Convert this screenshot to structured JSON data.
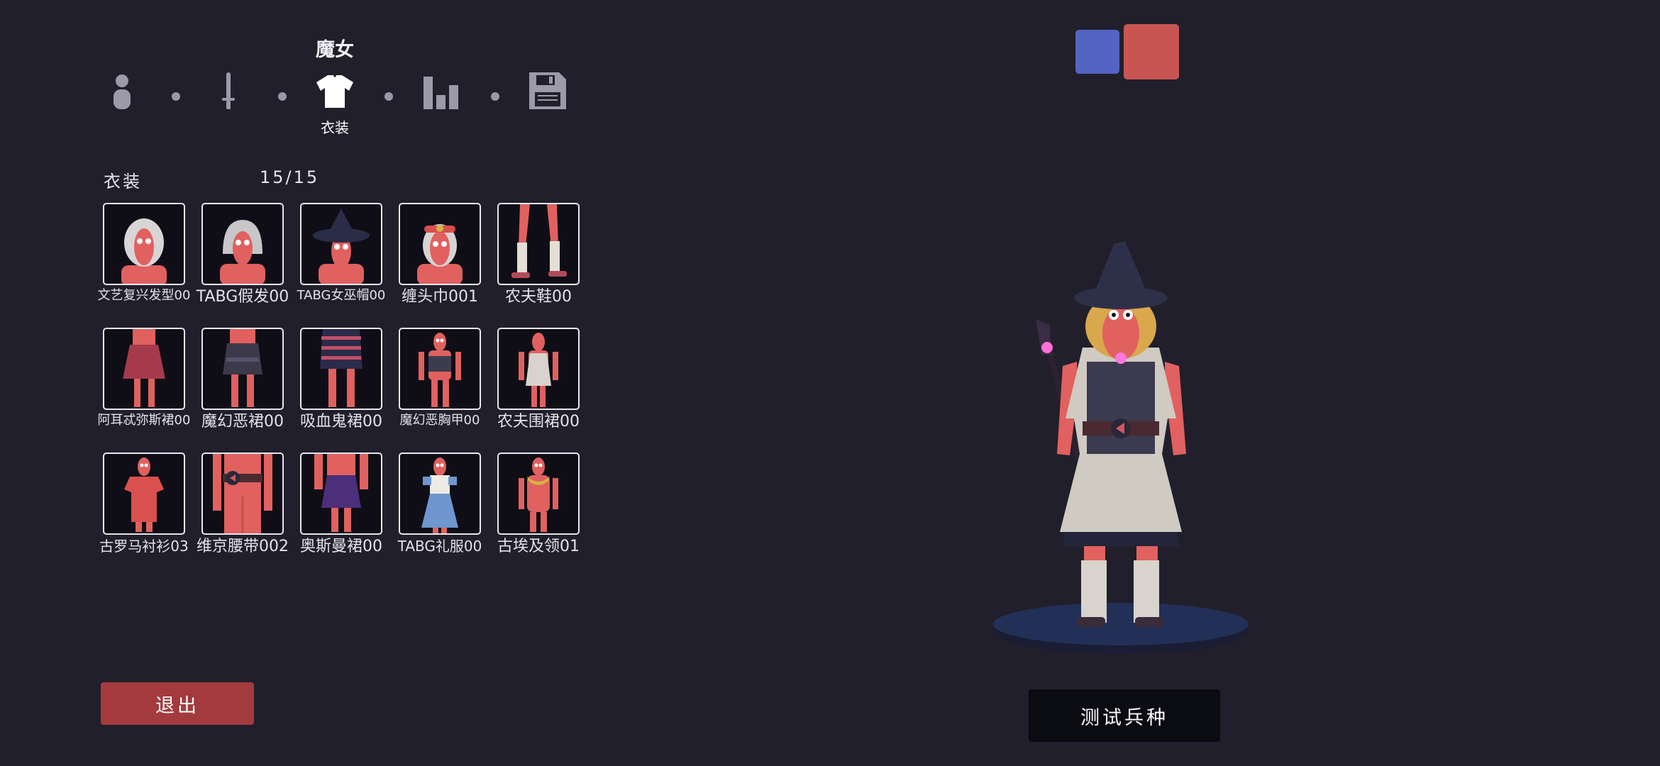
{
  "unit_name": "魔女",
  "steps": [
    {
      "icon": "person-icon",
      "label": ""
    },
    {
      "icon": "sword-icon",
      "label": ""
    },
    {
      "icon": "shirt-icon",
      "label": "衣装",
      "active": true
    },
    {
      "icon": "bar-chart-icon",
      "label": ""
    },
    {
      "icon": "save-icon",
      "label": ""
    }
  ],
  "section": {
    "title": "衣装",
    "count": "15/15"
  },
  "items": [
    {
      "label": "文艺复兴发型00",
      "thumb": "hair-long"
    },
    {
      "label": "TABG假发00",
      "thumb": "hair-bob"
    },
    {
      "label": "TABG女巫帽00",
      "thumb": "witch-hat"
    },
    {
      "label": "缠头巾001",
      "thumb": "headband"
    },
    {
      "label": "农夫鞋00",
      "thumb": "shoes"
    },
    {
      "label": "阿耳忒弥斯裙00",
      "thumb": "skirt-red"
    },
    {
      "label": "魔幻恶裙00",
      "thumb": "skirt-dark"
    },
    {
      "label": "吸血鬼裙00",
      "thumb": "skirt-striped"
    },
    {
      "label": "魔幻恶胸甲00",
      "thumb": "chest-armor"
    },
    {
      "label": "农夫围裙00",
      "thumb": "apron"
    },
    {
      "label": "古罗马衬衫03",
      "thumb": "tunic"
    },
    {
      "label": "维京腰带002",
      "thumb": "belt"
    },
    {
      "label": "奥斯曼裙00",
      "thumb": "skirt-purple"
    },
    {
      "label": "TABG礼服00",
      "thumb": "dress-blue"
    },
    {
      "label": "古埃及领01",
      "thumb": "collar"
    }
  ],
  "buttons": {
    "exit": "退出",
    "test": "测试兵种"
  },
  "colors": {
    "team_blue": "#5464c3",
    "team_red": "#c85552",
    "accent": "#a33b3e"
  }
}
